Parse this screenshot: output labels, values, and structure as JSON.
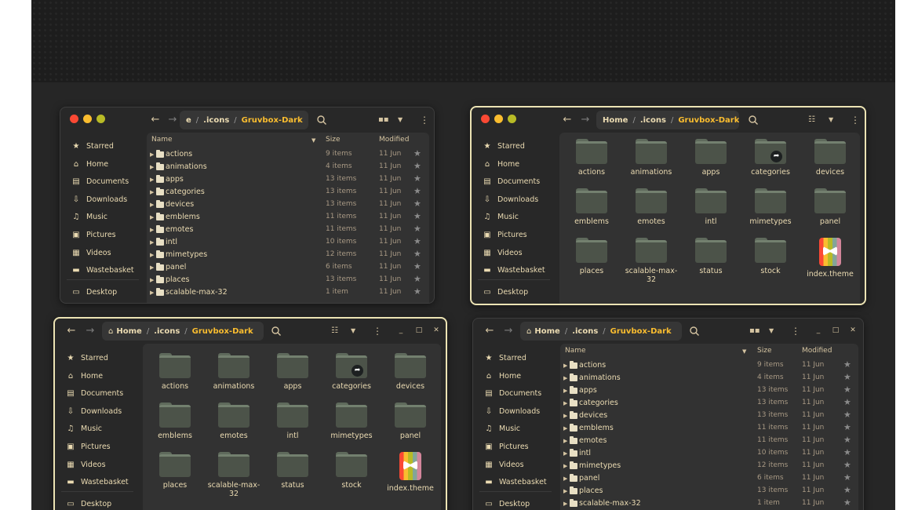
{
  "sidebar": {
    "starred": "Starred",
    "home": "Home",
    "documents": "Documents",
    "downloads": "Downloads",
    "music": "Music",
    "pictures": "Pictures",
    "videos": "Videos",
    "wastebasket": "Wastebasket",
    "desktop": "Desktop"
  },
  "path": {
    "home": "Home",
    "truncated_prefix": "e",
    "icons": ".icons",
    "current": "Gruvbox-Dark",
    "separator": "/"
  },
  "list": {
    "headers": {
      "name": "Name",
      "size": "Size",
      "modified": "Modified"
    },
    "rows": [
      {
        "name": "actions",
        "size": "9 items",
        "modified": "11 Jun"
      },
      {
        "name": "animations",
        "size": "4 items",
        "modified": "11 Jun"
      },
      {
        "name": "apps",
        "size": "13 items",
        "modified": "11 Jun"
      },
      {
        "name": "categories",
        "size": "13 items",
        "modified": "11 Jun"
      },
      {
        "name": "devices",
        "size": "13 items",
        "modified": "11 Jun"
      },
      {
        "name": "emblems",
        "size": "11 items",
        "modified": "11 Jun"
      },
      {
        "name": "emotes",
        "size": "11 items",
        "modified": "11 Jun"
      },
      {
        "name": "intl",
        "size": "10 items",
        "modified": "11 Jun"
      },
      {
        "name": "mimetypes",
        "size": "12 items",
        "modified": "11 Jun"
      },
      {
        "name": "panel",
        "size": "6 items",
        "modified": "11 Jun"
      },
      {
        "name": "places",
        "size": "13 items",
        "modified": "11 Jun"
      },
      {
        "name": "scalable-max-32",
        "size": "1 item",
        "modified": "11 Jun"
      }
    ]
  },
  "grid": {
    "items": [
      "actions",
      "animations",
      "apps",
      "categories",
      "devices",
      "emblems",
      "emotes",
      "intl",
      "mimetypes",
      "panel",
      "places",
      "scalable-max-32",
      "status",
      "stock",
      "index.theme"
    ]
  },
  "icons": {
    "back": "arrow-left-icon",
    "forward": "arrow-right-icon",
    "search": "search-icon",
    "view": "view-toggle-icon",
    "sort": "chevron-down-icon",
    "menu": "kebab-menu-icon",
    "minimize": "minimize-icon",
    "maximize": "maximize-icon",
    "close": "close-icon",
    "starred": "star-icon",
    "home": "home-icon",
    "documents": "document-icon",
    "downloads": "download-icon",
    "music": "music-note-icon",
    "pictures": "picture-icon",
    "videos": "film-icon",
    "wastebasket": "trash-icon",
    "desktop": "desktop-icon",
    "categories_emblem": "share-emblem-icon"
  },
  "colors": {
    "wallpaper": "#1d1d1d",
    "window_bg": "#282828",
    "content_bg": "#323232",
    "accent_yellow": "#fabd2f",
    "text": "#ebdbb2",
    "muted": "#a89984",
    "focus_border": "#ece3b4",
    "close_red": "#fb4934",
    "min_yellow": "#fabd2f",
    "max_green": "#b8bb26"
  }
}
